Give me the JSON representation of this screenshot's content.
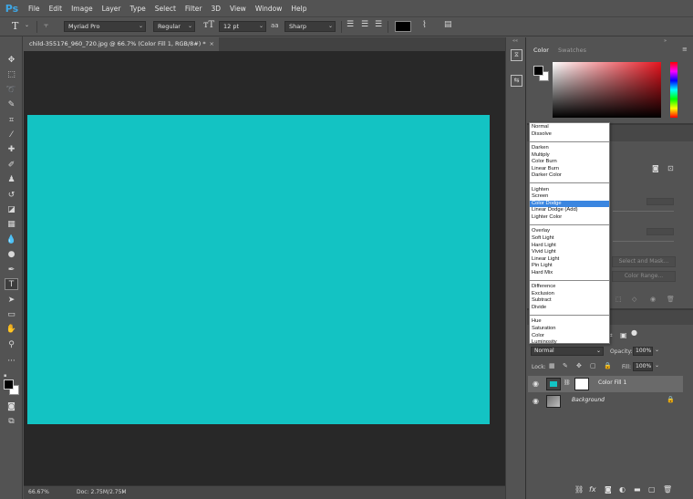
{
  "app": {
    "logo": "Ps",
    "menu": [
      "File",
      "Edit",
      "Image",
      "Layer",
      "Type",
      "Select",
      "Filter",
      "3D",
      "View",
      "Window",
      "Help"
    ]
  },
  "options_bar": {
    "tool_icon": "T",
    "font_family": "Myriad Pro",
    "font_style": "Regular",
    "font_size": "12 pt",
    "anti_alias": "Sharp",
    "text_color": "#000000"
  },
  "document": {
    "tab_title": "child-355176_960_720.jpg @ 66.7% (Color Fill 1, RGB/8#) *",
    "fill_color": "#13c3c3",
    "zoom": "66.67%",
    "doc_info": "Doc: 2.75M/2.75M"
  },
  "panels": {
    "color_tab": "Color",
    "swatches_tab": "Swatches",
    "select_and_mask": "Select and Mask...",
    "color_range": "Color Range..."
  },
  "layers": {
    "blend_mode": "Normal",
    "opacity_label": "Opacity:",
    "opacity_value": "100%",
    "lock_label": "Lock:",
    "fill_label": "Fill:",
    "fill_value": "100%",
    "items": [
      {
        "name": "Color Fill 1"
      },
      {
        "name": "Background"
      }
    ]
  },
  "blend_dropdown": {
    "groups": [
      [
        "Normal",
        "Dissolve"
      ],
      [
        "Darken",
        "Multiply",
        "Color Burn",
        "Linear Burn",
        "Darker Color"
      ],
      [
        "Lighten",
        "Screen",
        "Color Dodge",
        "Linear Dodge (Add)",
        "Lighter Color"
      ],
      [
        "Overlay",
        "Soft Light",
        "Hard Light",
        "Vivid Light",
        "Linear Light",
        "Pin Light",
        "Hard Mix"
      ],
      [
        "Difference",
        "Exclusion",
        "Subtract",
        "Divide"
      ],
      [
        "Hue",
        "Saturation",
        "Color",
        "Luminosity"
      ]
    ],
    "selected": "Color Dodge"
  },
  "colors": {
    "accent": "#3b86e0",
    "foreground": "#000000",
    "background": "#ffffff"
  }
}
